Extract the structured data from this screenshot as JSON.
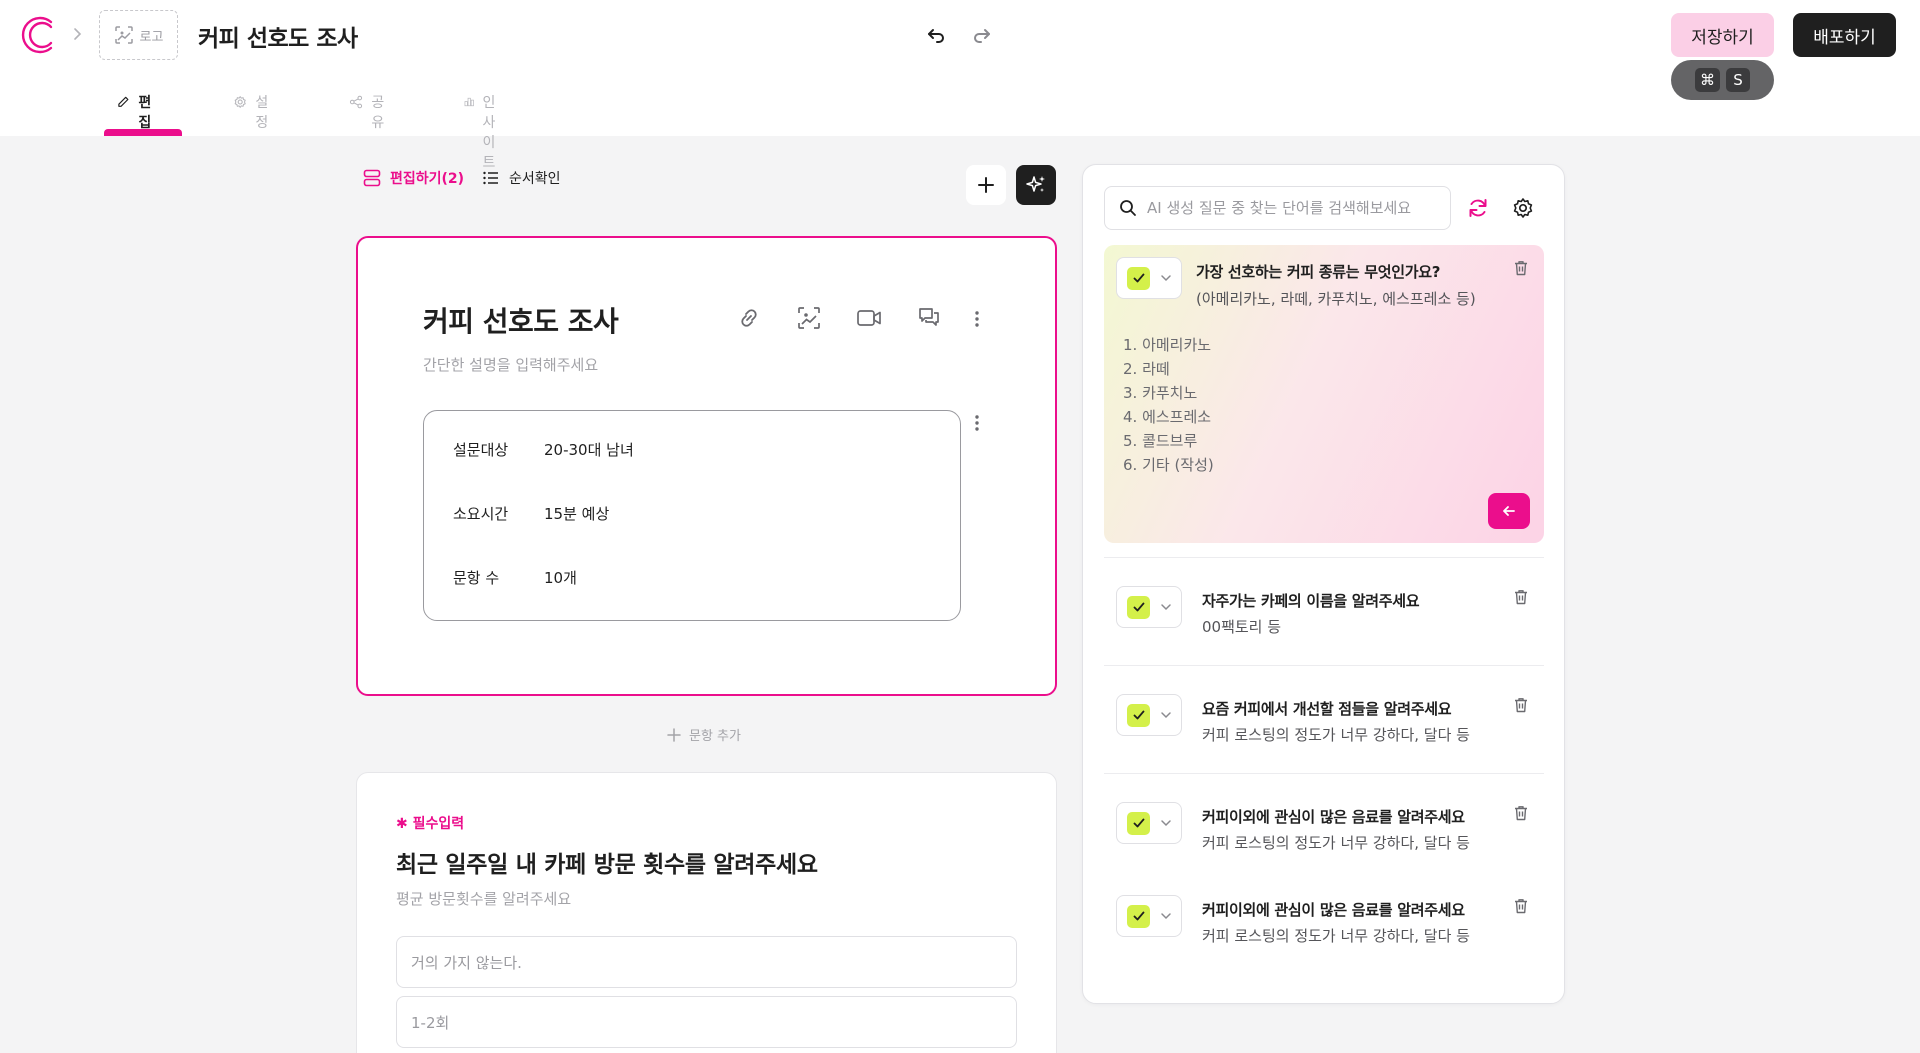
{
  "header": {
    "logo_placeholder": "로고",
    "doc_title": "커피 선호도 조사",
    "save_label": "저장하기",
    "shortcut_keys": [
      "⌘",
      "S"
    ],
    "deploy_label": "배포하기",
    "tabs": [
      {
        "label": "편집",
        "icon": "pencil-icon",
        "active": true
      },
      {
        "label": "설정",
        "icon": "gear-icon",
        "active": false
      },
      {
        "label": "공유",
        "icon": "share-icon",
        "active": false
      },
      {
        "label": "인사이트",
        "icon": "bar-chart-icon",
        "active": false
      }
    ]
  },
  "toolbar": {
    "edit_mode_label": "편집하기(2)",
    "order_check_label": "순서확인"
  },
  "survey": {
    "title": "커피 선호도 조사",
    "description_placeholder": "간단한 설명을 입력해주세요",
    "info": [
      {
        "key": "설문대상",
        "value": "20-30대 남녀"
      },
      {
        "key": "소요시간",
        "value": "15분 예상"
      },
      {
        "key": "문항 수",
        "value": "10개"
      }
    ],
    "add_question_label": "문항 추가"
  },
  "question": {
    "required_label": "필수입력",
    "title": "최근 일주일 내 카페 방문 횟수를 알려주세요",
    "description": "평균 방문횟수를 알려주세요",
    "options": [
      "거의 가지 않는다.",
      "1-2회"
    ]
  },
  "ai_panel": {
    "search_placeholder": "AI 생성 질문 중 찾는 단어를 검색해보세요",
    "selected": {
      "title": "가장 선호하는 커피 종류는 무엇인가요?",
      "subtitle": "(아메리카노, 라떼, 카푸치노, 에스프레소 등)",
      "options": [
        "1. 아메리카노",
        "2. 라떼",
        "3. 카푸치노",
        "4. 에스프레소",
        "5. 콜드브루",
        "6. 기타 (작성)"
      ]
    },
    "items": [
      {
        "title": "자주가는 카페의 이름을 알려주세요",
        "subtitle": "00팩토리 등"
      },
      {
        "title": "요즘 커피에서 개선할 점들을 알려주세요",
        "subtitle": "커피 로스팅의 정도가 너무 강하다, 달다 등"
      },
      {
        "title": "커피이외에 관심이 많은 음료를 알려주세요",
        "subtitle": "커피 로스팅의 정도가 너무 강하다, 달다 등"
      },
      {
        "title": "커피이외에 관심이 많은 음료를 알려주세요",
        "subtitle": "커피 로스팅의 정도가 너무 강하다, 달다 등"
      }
    ]
  },
  "colors": {
    "accent": "#eb0e8c",
    "save_button_bg": "#fbcfe6",
    "deploy_button_bg": "#1f1f1f",
    "checkbox_green": "#d4f04a"
  }
}
